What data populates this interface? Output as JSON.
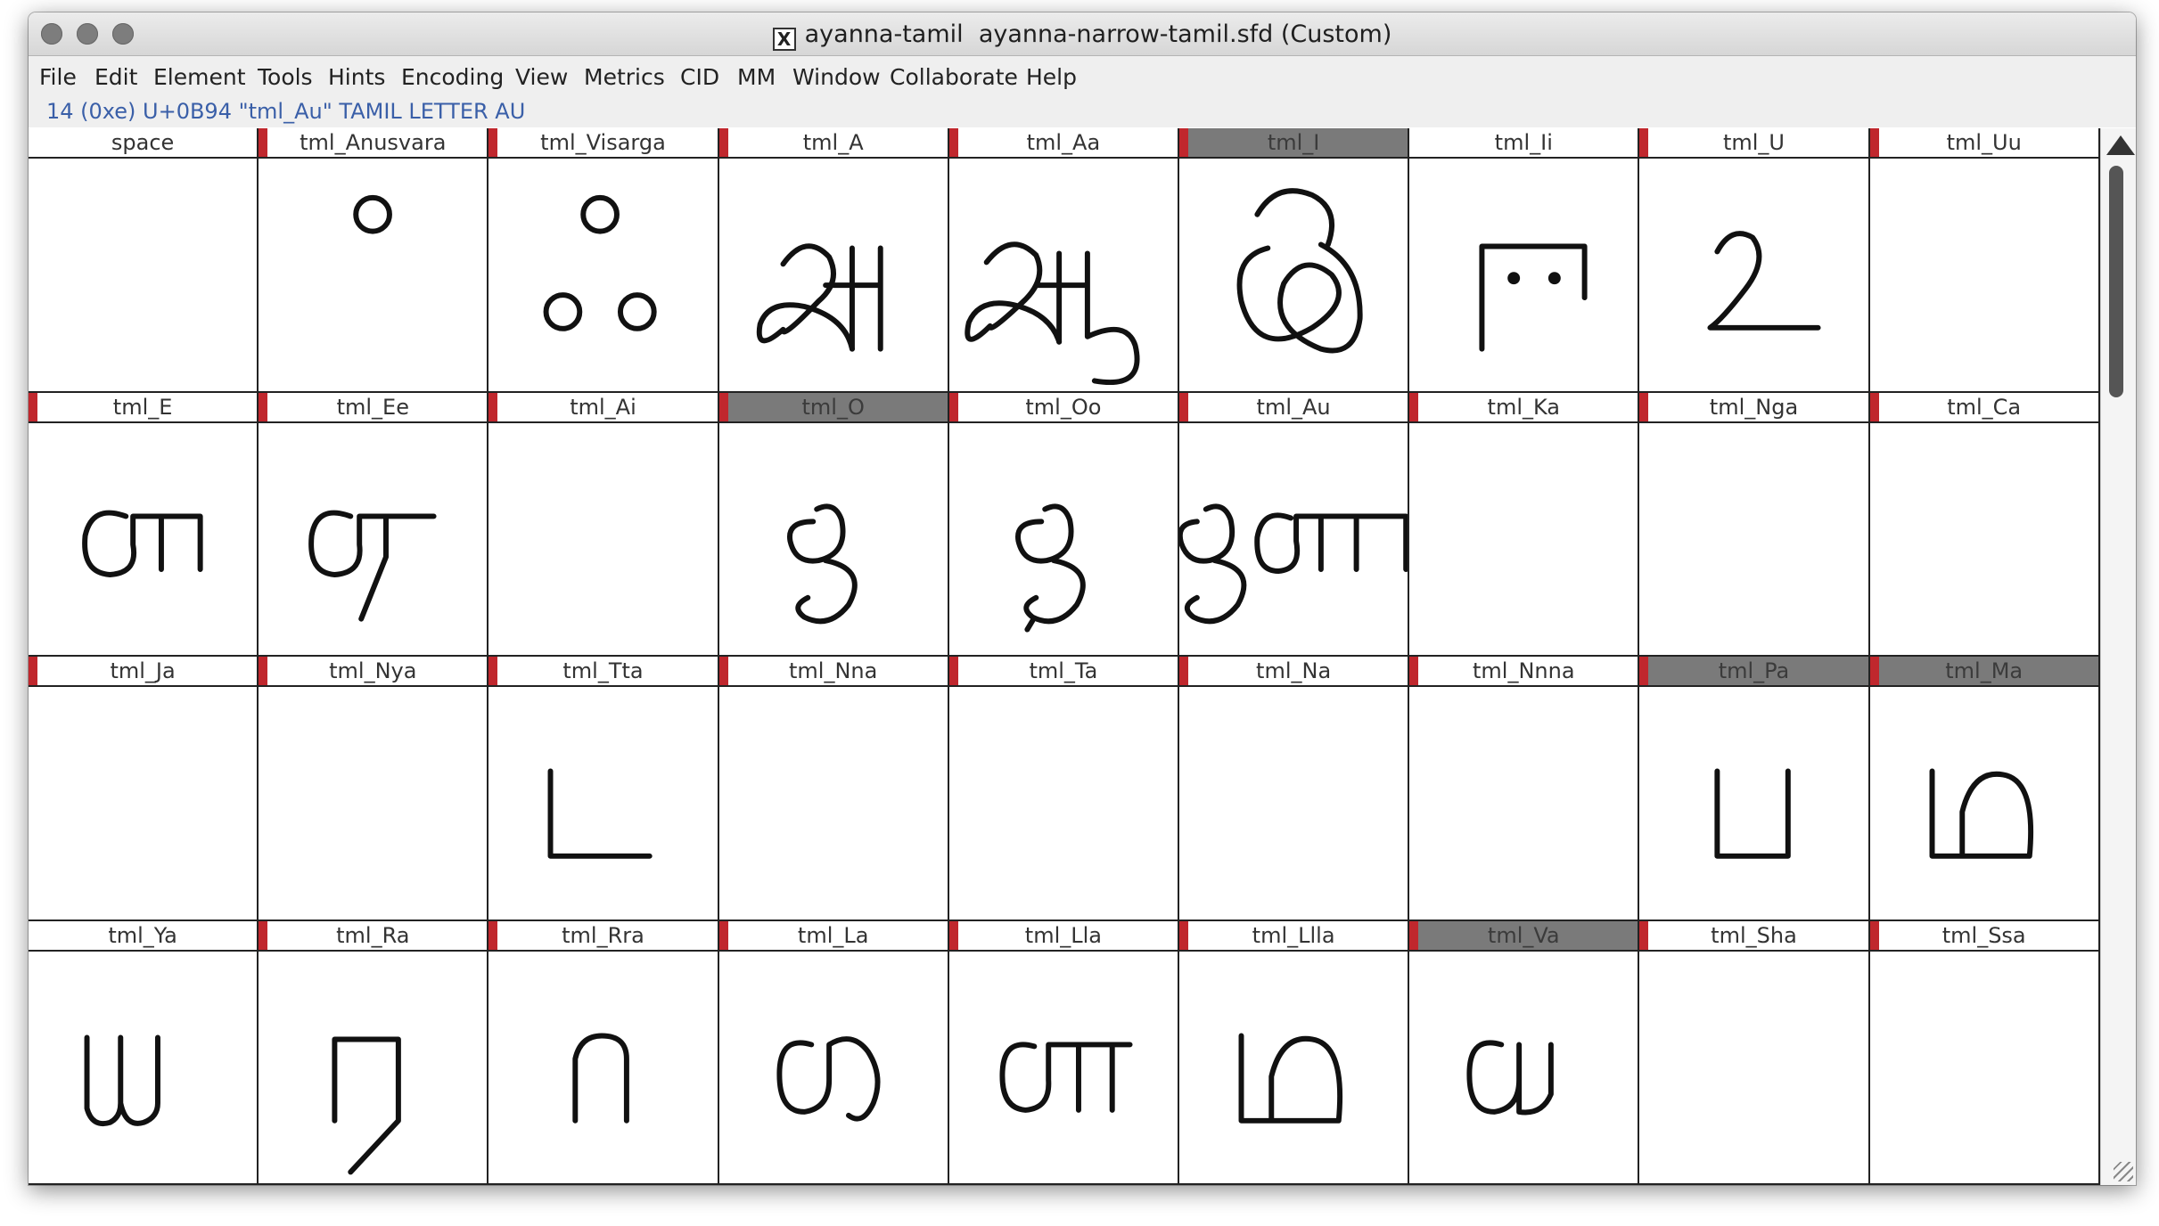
{
  "window": {
    "title_prefix": "ayanna-tamil",
    "title_file": "ayanna-narrow-tamil.sfd (Custom)",
    "x11_icon_glyph": "X"
  },
  "menu": [
    {
      "label": "File"
    },
    {
      "label": "Edit"
    },
    {
      "label": "Element"
    },
    {
      "label": "Tools"
    },
    {
      "label": "Hints"
    },
    {
      "label": "Encoding"
    },
    {
      "label": "View"
    },
    {
      "label": "Metrics"
    },
    {
      "label": "CID"
    },
    {
      "label": "MM"
    },
    {
      "label": "Window"
    },
    {
      "label": "Collaborate"
    },
    {
      "label": "Help"
    }
  ],
  "info": "14 (0xe) U+0B94 \"tml_Au\" TAMIL LETTER AU",
  "colors": {
    "selected_label_bg": "#7a7a7a",
    "changed_marker": "#c0272d",
    "info_text": "#3a5fa8"
  },
  "glyphs": [
    {
      "name": "space",
      "marked": false,
      "selected": false,
      "icon": "blank"
    },
    {
      "name": "tml_Anusvara",
      "marked": true,
      "selected": false,
      "icon": "anusvara-glyph"
    },
    {
      "name": "tml_Visarga",
      "marked": true,
      "selected": false,
      "icon": "visarga-glyph"
    },
    {
      "name": "tml_A",
      "marked": true,
      "selected": false,
      "icon": "tamil-a-glyph"
    },
    {
      "name": "tml_Aa",
      "marked": true,
      "selected": false,
      "icon": "tamil-aa-glyph"
    },
    {
      "name": "tml_I",
      "marked": true,
      "selected": true,
      "icon": "tamil-i-glyph"
    },
    {
      "name": "tml_Ii",
      "marked": false,
      "selected": false,
      "icon": "tamil-ii-glyph"
    },
    {
      "name": "tml_U",
      "marked": true,
      "selected": false,
      "icon": "tamil-u-glyph"
    },
    {
      "name": "tml_Uu",
      "marked": true,
      "selected": false,
      "icon": "blank"
    },
    {
      "name": "tml_E",
      "marked": true,
      "selected": false,
      "icon": "tamil-e-glyph"
    },
    {
      "name": "tml_Ee",
      "marked": true,
      "selected": false,
      "icon": "tamil-ee-glyph"
    },
    {
      "name": "tml_Ai",
      "marked": true,
      "selected": false,
      "icon": "blank"
    },
    {
      "name": "tml_O",
      "marked": true,
      "selected": true,
      "icon": "tamil-o-glyph"
    },
    {
      "name": "tml_Oo",
      "marked": true,
      "selected": false,
      "icon": "tamil-oo-glyph"
    },
    {
      "name": "tml_Au",
      "marked": true,
      "selected": false,
      "icon": "tamil-au-glyph"
    },
    {
      "name": "tml_Ka",
      "marked": true,
      "selected": false,
      "icon": "blank"
    },
    {
      "name": "tml_Nga",
      "marked": true,
      "selected": false,
      "icon": "blank"
    },
    {
      "name": "tml_Ca",
      "marked": true,
      "selected": false,
      "icon": "blank"
    },
    {
      "name": "tml_Ja",
      "marked": true,
      "selected": false,
      "icon": "blank"
    },
    {
      "name": "tml_Nya",
      "marked": true,
      "selected": false,
      "icon": "blank"
    },
    {
      "name": "tml_Tta",
      "marked": true,
      "selected": false,
      "icon": "tamil-tta-glyph"
    },
    {
      "name": "tml_Nna",
      "marked": true,
      "selected": false,
      "icon": "blank"
    },
    {
      "name": "tml_Ta",
      "marked": true,
      "selected": false,
      "icon": "blank"
    },
    {
      "name": "tml_Na",
      "marked": true,
      "selected": false,
      "icon": "blank"
    },
    {
      "name": "tml_Nnna",
      "marked": true,
      "selected": false,
      "icon": "blank"
    },
    {
      "name": "tml_Pa",
      "marked": true,
      "selected": true,
      "icon": "tamil-pa-glyph"
    },
    {
      "name": "tml_Ma",
      "marked": true,
      "selected": true,
      "icon": "tamil-ma-glyph"
    },
    {
      "name": "tml_Ya",
      "marked": false,
      "selected": false,
      "icon": "tamil-ya-glyph"
    },
    {
      "name": "tml_Ra",
      "marked": true,
      "selected": false,
      "icon": "tamil-ra-glyph"
    },
    {
      "name": "tml_Rra",
      "marked": true,
      "selected": false,
      "icon": "tamil-rra-glyph"
    },
    {
      "name": "tml_La",
      "marked": true,
      "selected": false,
      "icon": "tamil-la-glyph"
    },
    {
      "name": "tml_Lla",
      "marked": true,
      "selected": false,
      "icon": "tamil-lla-glyph"
    },
    {
      "name": "tml_Llla",
      "marked": true,
      "selected": false,
      "icon": "tamil-llla-glyph"
    },
    {
      "name": "tml_Va",
      "marked": true,
      "selected": true,
      "icon": "tamil-va-glyph"
    },
    {
      "name": "tml_Sha",
      "marked": true,
      "selected": false,
      "icon": "blank"
    },
    {
      "name": "tml_Ssa",
      "marked": true,
      "selected": false,
      "icon": "blank"
    }
  ]
}
